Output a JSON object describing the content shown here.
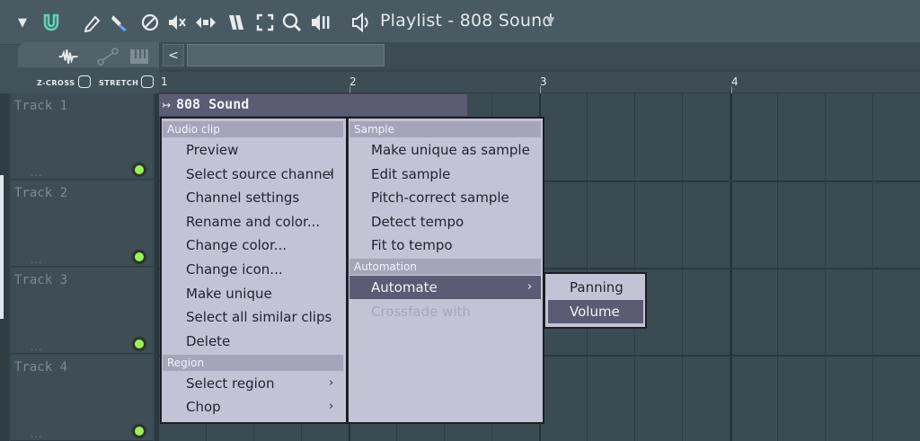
{
  "toolbar": {
    "title": "Playlist - 808 Sound",
    "icons": [
      "dropdown-arrow-icon",
      "magnet-icon",
      "pencil-icon",
      "paint-brush-icon",
      "delete-icon",
      "mute-icon",
      "slip-icon",
      "slice-icon",
      "select-icon",
      "zoom-icon",
      "playback-icon",
      "speaker-icon"
    ]
  },
  "options": {
    "zcross_label": "Z-CROSS",
    "stretch_label": "STRETCH"
  },
  "ruler": {
    "bars": [
      "1",
      "2",
      "3",
      "4"
    ]
  },
  "tracks": [
    {
      "name": "Track 1",
      "dots": "..."
    },
    {
      "name": "Track 2",
      "dots": "..."
    },
    {
      "name": "Track 3",
      "dots": "..."
    },
    {
      "name": "Track 4",
      "dots": "..."
    }
  ],
  "clip": {
    "title": "808 Sound",
    "color": "#5d5a74"
  },
  "menu_audio": {
    "section1": "Audio clip",
    "items1": [
      "Preview",
      "Select source channel",
      "Channel settings",
      "Rename and color...",
      "Change color...",
      "Change icon...",
      "Make unique",
      "Select all similar clips",
      "Delete"
    ],
    "section2": "Region",
    "items2": [
      "Select region",
      "Chop"
    ]
  },
  "menu_sample": {
    "section1": "Sample",
    "items1": [
      "Make unique as sample",
      "Edit sample",
      "Pitch-correct sample",
      "Detect tempo",
      "Fit to tempo"
    ],
    "section2": "Automation",
    "items2": [
      "Automate",
      "Crossfade with"
    ]
  },
  "menu_automate": {
    "items": [
      "Panning",
      "Volume"
    ]
  },
  "colors": {
    "menu_bg": "#c4c3d6",
    "menu_selected": "#5d5b74",
    "led": "#9cf05a"
  }
}
